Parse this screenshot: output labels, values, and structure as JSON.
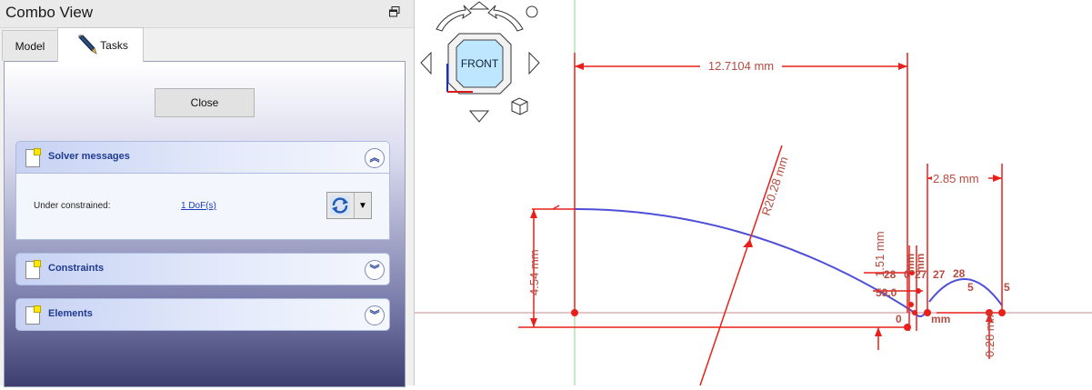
{
  "combo": {
    "title": "Combo View",
    "tabs": [
      {
        "label": "Model"
      },
      {
        "label": "Tasks"
      }
    ],
    "close_label": "Close",
    "solver": {
      "title": "Solver messages",
      "status_label": "Under constrained:",
      "status_value": "1 DoF(s)"
    },
    "constraints": {
      "title": "Constraints"
    },
    "elements": {
      "title": "Elements"
    }
  },
  "navcube": {
    "face_label": "FRONT"
  },
  "sketch": {
    "dimensions": {
      "d1": "12.7104 mm",
      "d2": "R20.28 mm",
      "d3": "4.54 mm",
      "d4": "2.85 mm",
      "d5": "1.51 mm",
      "d6": "0.28 mm"
    },
    "labels": {
      "l28a": "28",
      "l0a": "0",
      "l27a": "27",
      "l27b": "27",
      "l28b": "28",
      "l59": "59.0",
      "l5a": "5",
      "l5b": "5",
      "lmm1": "mm",
      "lmm2": "mm",
      "l0b": "0",
      "lmm3": "mm"
    },
    "colors": {
      "constraint": "#e8201b",
      "geometry": "#4e4ed8",
      "axis_h": "#c98a8a",
      "axis_v": "#7ed97e"
    }
  }
}
